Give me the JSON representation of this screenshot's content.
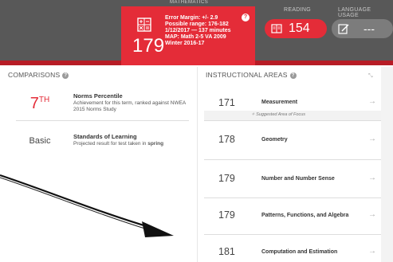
{
  "header": {
    "top_title": "MATHEMATICS",
    "math": {
      "score": "179",
      "details": [
        "Error Margin: +/- 2.9",
        "Possible range: 176-182",
        "1/12/2017 — 137 minutes",
        "MAP: Math 2-5 VA 2009",
        "Winter 2016-17"
      ],
      "help": "?"
    },
    "reading": {
      "label": "READING",
      "value": "154"
    },
    "language": {
      "label": "LANGUAGE USAGE",
      "value": "---"
    }
  },
  "comparisons": {
    "title": "COMPARISONS",
    "items": [
      {
        "big": "7",
        "sup": "TH",
        "title": "Norms Percentile",
        "desc1": "Achievement for this term, ranked against NWEA",
        "desc2": "2015 Norms Study"
      },
      {
        "big": "Basic",
        "title": "Standards of Learning",
        "desc_prefix": "Projected result for test taken in ",
        "desc_bold": "spring"
      }
    ]
  },
  "instructional": {
    "title": "INSTRUCTIONAL AREAS",
    "focus_label": "Suggested Area of Focus",
    "areas": [
      {
        "score": "171",
        "name": "Measurement"
      },
      {
        "score": "178",
        "name": "Geometry"
      },
      {
        "score": "179",
        "name": "Number and Number Sense"
      },
      {
        "score": "179",
        "name": "Patterns, Functions, and Algebra"
      },
      {
        "score": "181",
        "name": "Computation and Estimation"
      }
    ]
  },
  "colors": {
    "accent": "#e42c38",
    "header": "#585858",
    "grey_pill": "#7c7c7c"
  },
  "icons": [
    "calculator-icon",
    "book-icon",
    "pencil-icon",
    "help-icon",
    "collapse-icon",
    "arrow-right-icon",
    "focus-icon"
  ]
}
